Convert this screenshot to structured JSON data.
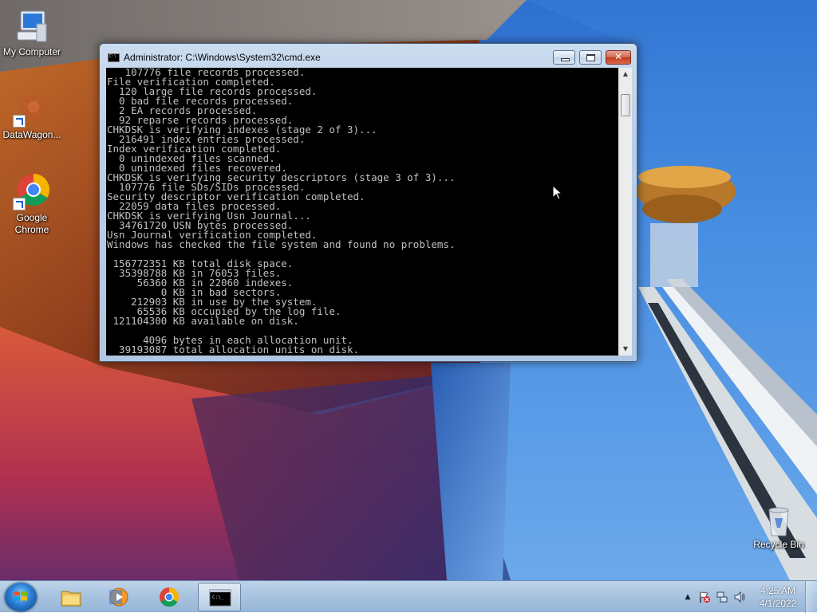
{
  "desktop": {
    "icons": [
      {
        "label": "My Computer",
        "icon": "computer-icon"
      },
      {
        "label": "DataWagon...",
        "icon": "datawagon-icon"
      },
      {
        "label": "Google\nChrome",
        "label_line1": "Google",
        "label_line2": "Chrome",
        "icon": "chrome-icon"
      },
      {
        "label": "Recycle Bin",
        "icon": "recycle-bin-icon"
      }
    ]
  },
  "window": {
    "title": "Administrator: C:\\Windows\\System32\\cmd.exe",
    "icon": "cmd-icon",
    "buttons": {
      "minimize": "minimize-icon",
      "maximize": "maximize-icon",
      "close": "close-icon"
    },
    "console_text": "   107776 file records processed.\nFile verification completed.\n  120 large file records processed.\n  0 bad file records processed.\n  2 EA records processed.\n  92 reparse records processed.\nCHKDSK is verifying indexes (stage 2 of 3)...\n  216491 index entries processed.\nIndex verification completed.\n  0 unindexed files scanned.\n  0 unindexed files recovered.\nCHKDSK is verifying security descriptors (stage 3 of 3)...\n  107776 file SDs/SIDs processed.\nSecurity descriptor verification completed.\n  22059 data files processed.\nCHKDSK is verifying Usn Journal...\n  34761720 USN bytes processed.\nUsn Journal verification completed.\nWindows has checked the file system and found no problems.\n\n 156772351 KB total disk space.\n  35398788 KB in 76053 files.\n     56360 KB in 22060 indexes.\n         0 KB in bad sectors.\n    212903 KB in use by the system.\n     65536 KB occupied by the log file.\n 121104300 KB available on disk.\n\n      4096 bytes in each allocation unit.\n  39193087 total allocation units on disk."
  },
  "taskbar": {
    "start": "windows-start-icon",
    "items": [
      {
        "name": "file-explorer",
        "icon": "folder-icon"
      },
      {
        "name": "media-player",
        "icon": "media-player-icon"
      },
      {
        "name": "chrome",
        "icon": "chrome-icon"
      },
      {
        "name": "cmd",
        "icon": "cmd-icon",
        "active": true
      }
    ],
    "tray": {
      "icons": [
        "show-hidden-icons-icon",
        "action-center-flag-icon",
        "network-icon",
        "volume-icon"
      ],
      "time": "4:25 AM",
      "date": "4/1/2022"
    }
  },
  "colors": {
    "console_bg": "#000000",
    "console_fg": "#c0c0c0",
    "close_button": "#c8462a"
  }
}
